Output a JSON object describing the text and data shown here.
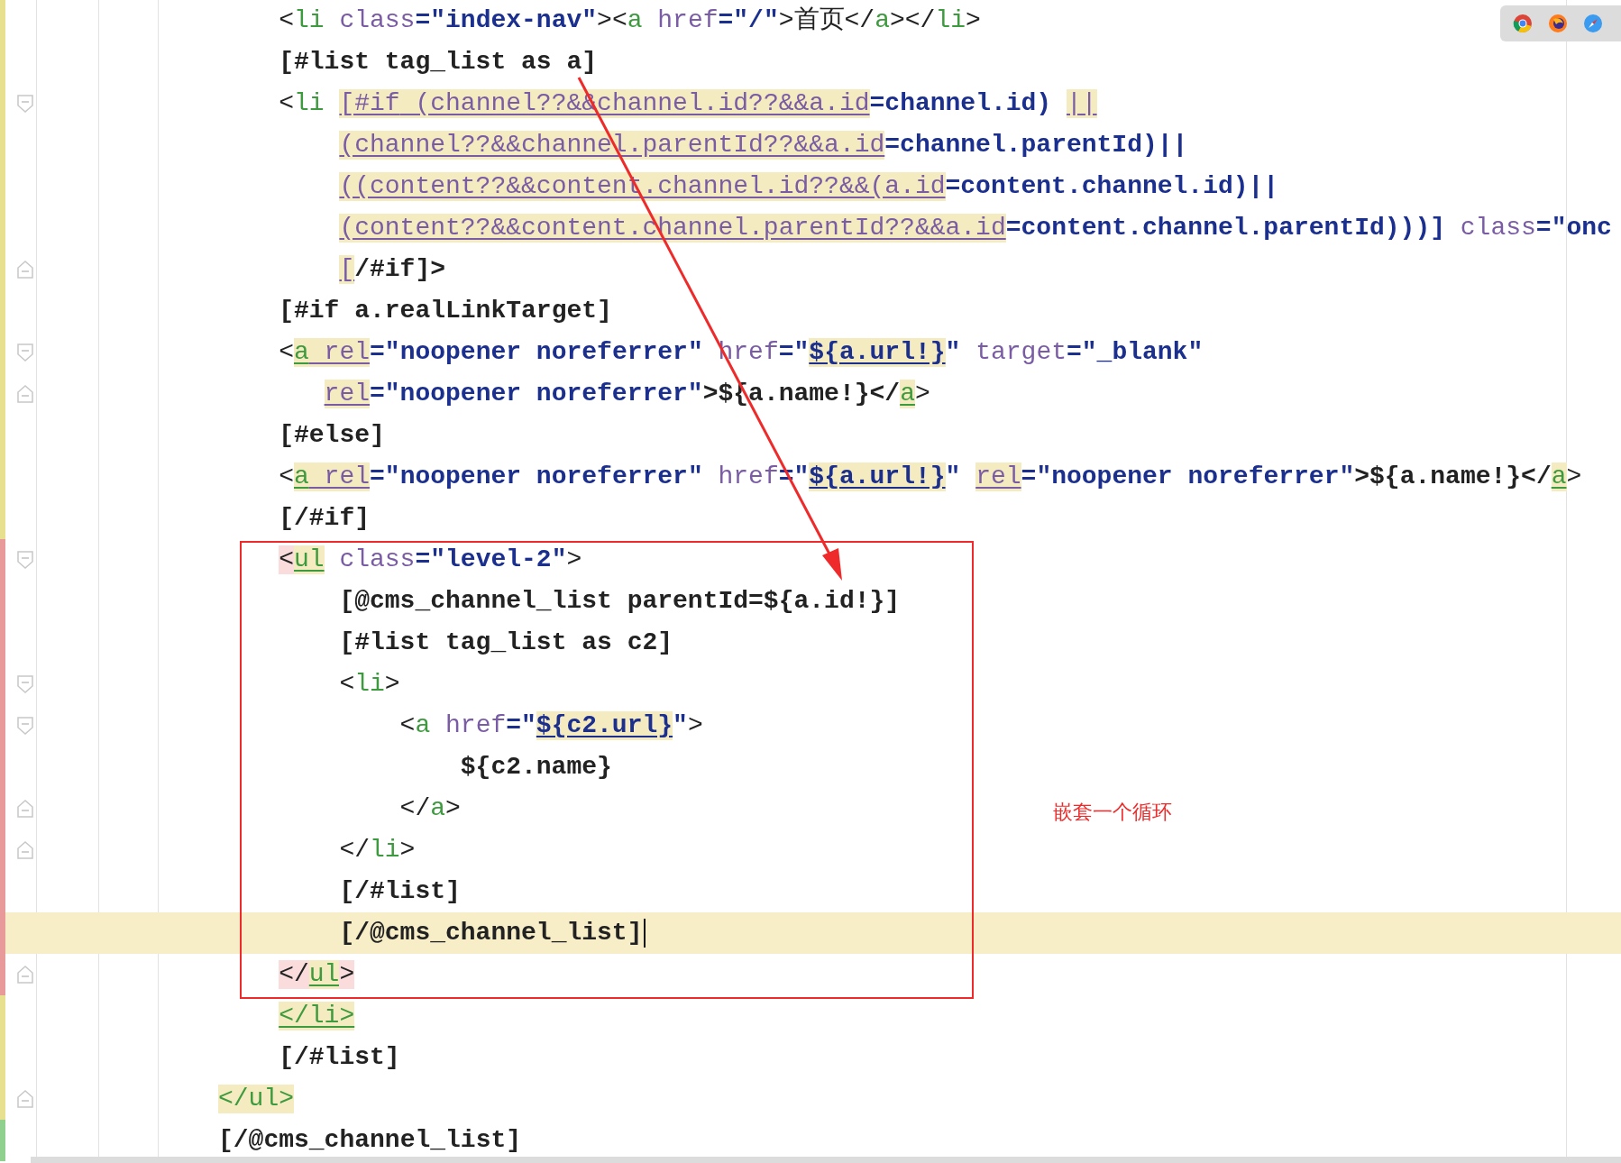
{
  "editor": {
    "lines": [
      {
        "color": "#e6e08f",
        "segments": [
          {
            "text": "    <",
            "kind": "punct"
          },
          {
            "text": "li",
            "kind": "tag"
          },
          {
            "text": " class",
            "kind": "attr"
          },
          {
            "text": "=\"index-nav\"",
            "kind": "string"
          },
          {
            "text": "><",
            "kind": "punct"
          },
          {
            "text": "a",
            "kind": "tag"
          },
          {
            "text": " href",
            "kind": "attr"
          },
          {
            "text": "=\"/\"",
            "kind": "string"
          },
          {
            "text": ">首页</",
            "kind": "punct"
          },
          {
            "text": "a",
            "kind": "tag"
          },
          {
            "text": "></",
            "kind": "punct"
          },
          {
            "text": "li",
            "kind": "tag"
          },
          {
            "text": ">",
            "kind": "punct"
          }
        ]
      },
      {
        "color": "#e6e08f",
        "segments": [
          {
            "text": "    [#list tag_list as a]",
            "kind": "directive"
          }
        ]
      },
      {
        "color": "#e6e08f",
        "fold_start": true,
        "segments": [
          {
            "text": "    <",
            "kind": "punct"
          },
          {
            "text": "li ",
            "kind": "tag"
          },
          {
            "text": "[#if",
            "kind": "expr",
            "highlighted": true
          },
          {
            "text": " (channel??&&channel.id??&&a.id",
            "kind": "expr",
            "highlighted": true
          },
          {
            "text": "=channel.id) ",
            "kind": "string"
          },
          {
            "text": "||",
            "kind": "expr",
            "highlighted": true
          }
        ]
      },
      {
        "color": "#e6e08f",
        "segments": [
          {
            "text": "        (channel??&&channel.parentId??&&a.id",
            "kind": "expr",
            "highlighted": true
          },
          {
            "text": "=channel.parentId)||",
            "kind": "string"
          }
        ]
      },
      {
        "color": "#e6e08f",
        "segments": [
          {
            "text": "        ((content??&&content.channel.id??&&(a.id",
            "kind": "expr",
            "highlighted": true
          },
          {
            "text": "=content.channel.id)||",
            "kind": "string"
          }
        ]
      },
      {
        "color": "#e6e08f",
        "segments": [
          {
            "text": "        (content??&&content.channel.parentId??&&a.id",
            "kind": "expr",
            "highlighted": true
          },
          {
            "text": "=content.channel.parentId)))]",
            "kind": "string"
          },
          {
            "text": " class",
            "kind": "attr"
          },
          {
            "text": "=\"onc",
            "kind": "string"
          }
        ]
      },
      {
        "color": "#e6e08f",
        "fold_end": true,
        "segments": [
          {
            "text": "        [",
            "kind": "expr",
            "highlighted": true
          },
          {
            "text": "/#if]>",
            "kind": "directive"
          }
        ]
      },
      {
        "color": "#e6e08f",
        "segments": [
          {
            "text": "    [#if a.realLinkTarget]",
            "kind": "directive"
          }
        ]
      },
      {
        "color": "#e6e08f",
        "fold_start": true,
        "segments": [
          {
            "text": "    <",
            "kind": "punct"
          },
          {
            "text": "a",
            "kind": "tag",
            "highlighted": true
          },
          {
            "text": " rel",
            "kind": "attr",
            "highlighted": true
          },
          {
            "text": "=\"noopener noreferrer\"",
            "kind": "string"
          },
          {
            "text": " href",
            "kind": "attr"
          },
          {
            "text": "=\"",
            "kind": "string"
          },
          {
            "text": "${a.url!}",
            "kind": "string",
            "highlighted": true
          },
          {
            "text": "\"",
            "kind": "string"
          },
          {
            "text": " target",
            "kind": "attr"
          },
          {
            "text": "=\"_blank\"",
            "kind": "string"
          }
        ]
      },
      {
        "color": "#e6e08f",
        "fold_end": true,
        "segments": [
          {
            "text": "       rel",
            "kind": "attr",
            "highlighted": true
          },
          {
            "text": "=\"noopener noreferrer\"",
            "kind": "string"
          },
          {
            "text": ">${a.name!}</",
            "kind": "directive"
          },
          {
            "text": "a",
            "kind": "tag",
            "highlighted": true
          },
          {
            "text": ">",
            "kind": "punct"
          }
        ]
      },
      {
        "color": "#e6e08f",
        "segments": [
          {
            "text": "    [#else]",
            "kind": "directive"
          }
        ]
      },
      {
        "color": "#e6e08f",
        "segments": [
          {
            "text": "    <",
            "kind": "punct"
          },
          {
            "text": "a",
            "kind": "tag",
            "highlighted": true
          },
          {
            "text": " rel",
            "kind": "attr",
            "highlighted": true
          },
          {
            "text": "=\"noopener noreferrer\"",
            "kind": "string"
          },
          {
            "text": " href",
            "kind": "attr"
          },
          {
            "text": "=\"",
            "kind": "string"
          },
          {
            "text": "${a.url!}",
            "kind": "string",
            "highlighted": true
          },
          {
            "text": "\" ",
            "kind": "string"
          },
          {
            "text": "rel",
            "kind": "attr",
            "highlighted": true
          },
          {
            "text": "=\"noopener noreferrer\"",
            "kind": "string"
          },
          {
            "text": ">${a.name!}</",
            "kind": "directive"
          },
          {
            "text": "a",
            "kind": "tag",
            "highlighted": true
          },
          {
            "text": ">",
            "kind": "punct"
          }
        ]
      },
      {
        "color": "#e6e08f",
        "segments": [
          {
            "text": "    [/#if]",
            "kind": "directive"
          }
        ]
      },
      {
        "color": "#e89a9a",
        "fold_start": true,
        "segments": [
          {
            "text": "    <",
            "kind": "punct",
            "paired": true
          },
          {
            "text": "ul",
            "kind": "tag",
            "highlighted": true
          },
          {
            "text": " class",
            "kind": "attr"
          },
          {
            "text": "=\"level-2\"",
            "kind": "string"
          },
          {
            "text": ">",
            "kind": "punct"
          }
        ]
      },
      {
        "color": "#e89a9a",
        "segments": [
          {
            "text": "        [@cms_channel_list parentId=${a.id!}]",
            "kind": "directive"
          }
        ]
      },
      {
        "color": "#e89a9a",
        "segments": [
          {
            "text": "        [#list tag_list as c2]",
            "kind": "directive"
          }
        ]
      },
      {
        "color": "#e89a9a",
        "fold_start": true,
        "segments": [
          {
            "text": "        <",
            "kind": "punct"
          },
          {
            "text": "li",
            "kind": "tag"
          },
          {
            "text": ">",
            "kind": "punct"
          }
        ]
      },
      {
        "color": "#e89a9a",
        "fold_start": true,
        "segments": [
          {
            "text": "            <",
            "kind": "punct"
          },
          {
            "text": "a",
            "kind": "tag"
          },
          {
            "text": " href",
            "kind": "attr"
          },
          {
            "text": "=\"",
            "kind": "string"
          },
          {
            "text": "${c2.url}",
            "kind": "string",
            "highlighted": true
          },
          {
            "text": "\"",
            "kind": "string"
          },
          {
            "text": ">",
            "kind": "punct"
          }
        ]
      },
      {
        "color": "#e89a9a",
        "segments": [
          {
            "text": "                ${c2.name}",
            "kind": "directive"
          }
        ]
      },
      {
        "color": "#e89a9a",
        "fold_end": true,
        "segments": [
          {
            "text": "            </",
            "kind": "punct"
          },
          {
            "text": "a",
            "kind": "tag"
          },
          {
            "text": ">",
            "kind": "punct"
          }
        ]
      },
      {
        "color": "#e89a9a",
        "fold_end": true,
        "segments": [
          {
            "text": "        </",
            "kind": "punct"
          },
          {
            "text": "li",
            "kind": "tag"
          },
          {
            "text": ">",
            "kind": "punct"
          }
        ]
      },
      {
        "color": "#e89a9a",
        "segments": [
          {
            "text": "        [/#list]",
            "kind": "directive"
          }
        ]
      },
      {
        "color": "#e89a9a",
        "current": true,
        "cursor": true,
        "segments": [
          {
            "text": "        [/@cms_channel_list]",
            "kind": "directive"
          }
        ]
      },
      {
        "color": "#e89a9a",
        "fold_end": true,
        "segments": [
          {
            "text": "    </",
            "kind": "punct",
            "paired": true
          },
          {
            "text": "ul",
            "kind": "tag",
            "highlighted": true
          },
          {
            "text": ">",
            "kind": "punct",
            "paired": true
          }
        ]
      },
      {
        "color": "#e6e08f",
        "segments": [
          {
            "text": "    </li>",
            "kind": "tag",
            "highlighted": true
          }
        ]
      },
      {
        "color": "#e6e08f",
        "segments": [
          {
            "text": "    [/#list]",
            "kind": "directive"
          }
        ]
      },
      {
        "color": "#e6e08f",
        "fold_end": true,
        "segments": [
          {
            "text": "</ul>",
            "kind": "tag",
            "paired": false,
            "filled": true
          }
        ]
      },
      {
        "color": "#8fd08f",
        "segments": [
          {
            "text": "[/@cms_channel_list]",
            "kind": "directive"
          }
        ]
      }
    ]
  },
  "annotation": {
    "note": "嵌套一个循环"
  }
}
